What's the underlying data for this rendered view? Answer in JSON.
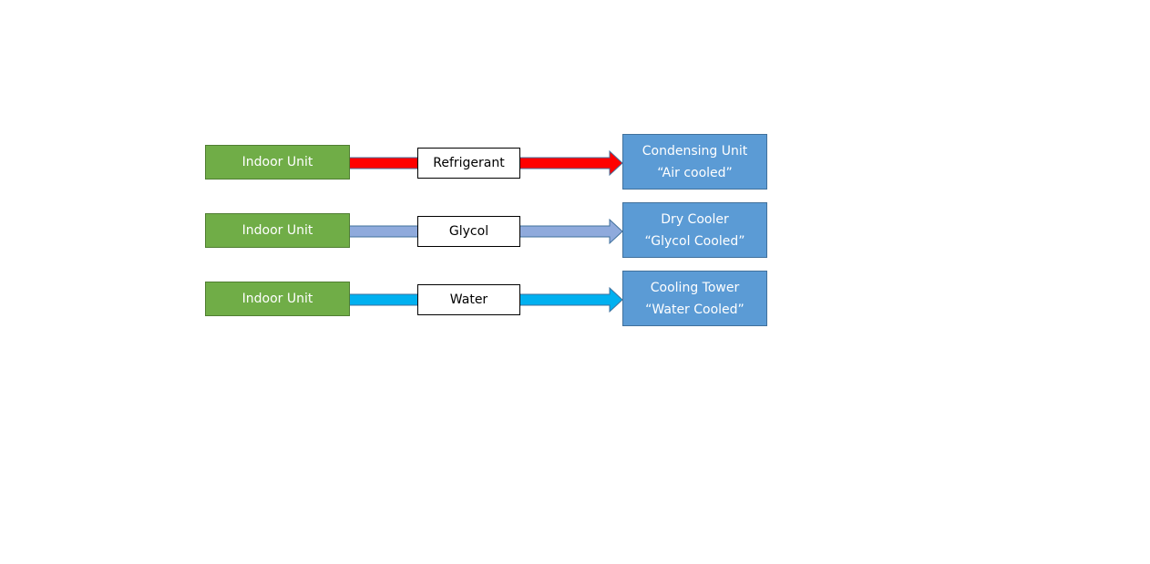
{
  "rows": [
    {
      "source": "Indoor Unit",
      "medium": "Refrigerant",
      "target_line1": "Condensing Unit",
      "target_line2": "“Air cooled”",
      "arrow_color": "#ff0000"
    },
    {
      "source": "Indoor Unit",
      "medium": "Glycol",
      "target_line1": "Dry Cooler",
      "target_line2": "“Glycol Cooled”",
      "arrow_color": "#8faadc"
    },
    {
      "source": "Indoor Unit",
      "medium": "Water",
      "target_line1": "Cooling Tower",
      "target_line2": "“Water Cooled”",
      "arrow_color": "#00b0f0"
    }
  ]
}
